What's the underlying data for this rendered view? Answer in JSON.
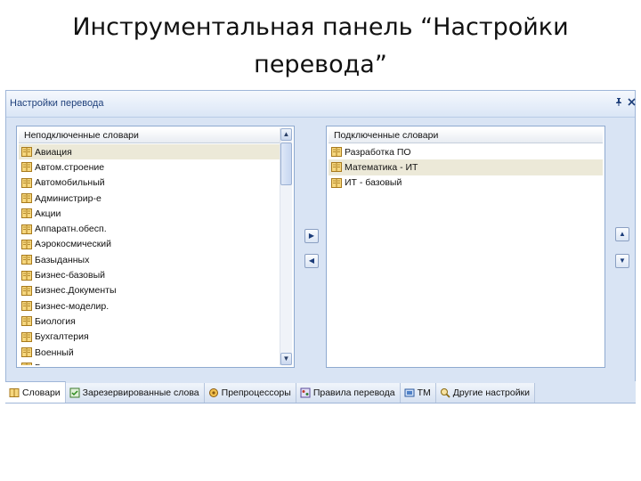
{
  "slide": {
    "title_line1": "Инструментальная панель “Настройки",
    "title_line2": "перевода”"
  },
  "panel": {
    "title": "Настройки перевода",
    "pin_icon": "pin-icon",
    "close_icon": "close-icon"
  },
  "left_list": {
    "header": "Неподключенные словари",
    "items": [
      {
        "label": "Авиация",
        "selected": true
      },
      {
        "label": "Автом.строение",
        "selected": false
      },
      {
        "label": "Автомобильный",
        "selected": false
      },
      {
        "label": "Администрир-е",
        "selected": false
      },
      {
        "label": "Акции",
        "selected": false
      },
      {
        "label": "Аппаратн.обесп.",
        "selected": false
      },
      {
        "label": "Аэрокосмический",
        "selected": false
      },
      {
        "label": "Базыданных",
        "selected": false
      },
      {
        "label": "Бизнес-базовый",
        "selected": false
      },
      {
        "label": "Бизнес.Документы",
        "selected": false
      },
      {
        "label": "Бизнес-моделир.",
        "selected": false
      },
      {
        "label": "Биология",
        "selected": false
      },
      {
        "label": "Бухгалтерия",
        "selected": false
      },
      {
        "label": "Военный",
        "selected": false
      },
      {
        "label": "Геология",
        "selected": false
      }
    ]
  },
  "right_list": {
    "header": "Подключенные словари",
    "items": [
      {
        "label": "Разработка ПО",
        "selected": false
      },
      {
        "label": "Математика - ИТ",
        "selected": true
      },
      {
        "label": "ИТ - базовый",
        "selected": false
      }
    ]
  },
  "tabs": [
    {
      "label": "Словари",
      "icon": "dictionary-icon",
      "active": true
    },
    {
      "label": "Зарезервированные слова",
      "icon": "reserved-words-icon",
      "active": false
    },
    {
      "label": "Препроцессоры",
      "icon": "preprocessor-icon",
      "active": false
    },
    {
      "label": "Правила перевода",
      "icon": "rules-icon",
      "active": false
    },
    {
      "label": "TM",
      "icon": "tm-icon",
      "active": false
    },
    {
      "label": "Другие настройки",
      "icon": "settings-icon",
      "active": false
    }
  ],
  "colors": {
    "panel_bg": "#d9e4f4",
    "header_text": "#1e3f7a",
    "selected_row": "#ece9d8",
    "book_icon": "#e8b84a"
  }
}
